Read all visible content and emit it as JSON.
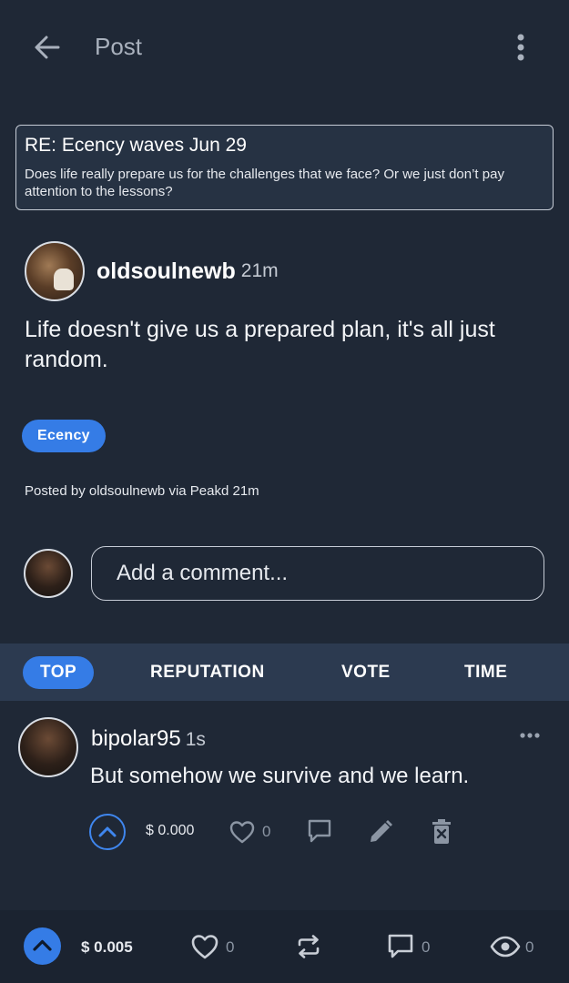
{
  "header": {
    "title": "Post",
    "back_icon": "arrow-left-icon",
    "menu_icon": "more-vertical-icon"
  },
  "parent_post": {
    "title": "RE: Ecency waves Jun 29",
    "body": "Does life really prepare us for the challenges that we face? Or we just don’t pay attention to the lessons?"
  },
  "post": {
    "author": "oldsoulnewb",
    "time": "21m",
    "body": "Life doesn't give us a prepared plan, it's all just random.",
    "tag": "Ecency",
    "posted_by": "Posted by oldsoulnewb via Peakd 21m"
  },
  "comment_box": {
    "placeholder": "Add a comment..."
  },
  "sort_tabs": [
    {
      "label": "TOP",
      "active": true
    },
    {
      "label": "REPUTATION",
      "active": false
    },
    {
      "label": "VOTE",
      "active": false
    },
    {
      "label": "TIME",
      "active": false
    }
  ],
  "reply": {
    "author": "bipolar95",
    "time": "1s",
    "body": "But somehow we survive and we learn.",
    "payout": "$ 0.000",
    "likes": "0"
  },
  "bottom_bar": {
    "payout": "$ 0.005",
    "likes": "0",
    "comments": "0",
    "views": "0"
  },
  "colors": {
    "background": "#1f2836",
    "accent": "#357ce6",
    "sort_bar": "#2c3a50"
  }
}
